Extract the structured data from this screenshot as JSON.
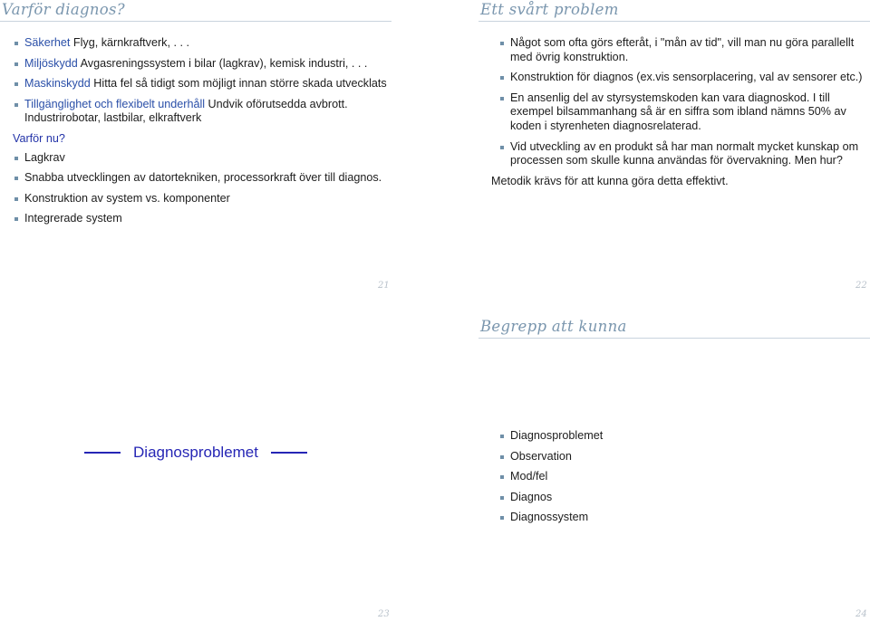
{
  "handout": {
    "slides": [
      {
        "page_number": "21",
        "title": "Varför diagnos?",
        "items": [
          {
            "keyword": "Säkerhet",
            "text": " Flyg, kärnkraftverk, . . ."
          },
          {
            "keyword": "Miljöskydd",
            "text": " Avgasreningssystem i bilar (lagkrav), kemisk industri, . . ."
          },
          {
            "keyword": "Maskinskydd",
            "text": " Hitta fel så tidigt som möjligt innan större skada utvecklats"
          },
          {
            "keyword": "Tillgänglighet och flexibelt underhåll",
            "text": " Undvik oförutsedda avbrott. Industrirobotar, lastbilar, elkraftverk"
          }
        ],
        "block_title": "Varför nu?",
        "block_items": [
          "Lagkrav",
          "Snabba utvecklingen av datortekniken, processorkraft över till diagnos.",
          "Konstruktion av system vs. komponenter",
          "Integrerade system"
        ]
      },
      {
        "page_number": "22",
        "title": "Ett svårt problem",
        "items": [
          "Något som ofta görs efteråt, i \"mån av tid\", vill man nu göra parallellt med övrig konstruktion.",
          "Konstruktion för diagnos (ex.vis sensorplacering, val av sensorer etc.)",
          "En ansenlig del av styrsystemskoden kan vara diagnoskod. I till exempel bilsammanhang så är en siffra som ibland nämns 50% av koden i styrenheten diagnosrelaterad.",
          "Vid utveckling av en produkt så har man normalt mycket kunskap om processen som skulle kunna användas för övervakning. Men hur?"
        ],
        "closing": "Metodik krävs för att kunna göra detta effektivt."
      },
      {
        "page_number": "23",
        "section_title": "Diagnosproblemet"
      },
      {
        "page_number": "24",
        "title": "Begrepp att kunna",
        "items": [
          "Diagnosproblemet",
          "Observation",
          "Mod/fel",
          "Diagnos",
          "Diagnossystem"
        ]
      }
    ]
  },
  "colors": {
    "frame_title": "#7a96ae",
    "title_rule": "#c9d4de",
    "keyword_blue": "#2a4fa8",
    "block_title_blue": "#2333a8",
    "section_blue": "#2626b5",
    "bullet": "#6f8fa8",
    "page_number": "#b9c2cb",
    "body_text": "#1c1c1c"
  }
}
